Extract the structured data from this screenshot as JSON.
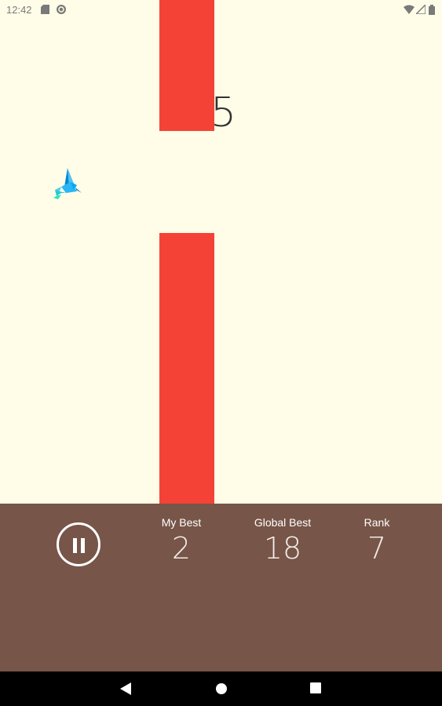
{
  "status_bar": {
    "time": "12:42"
  },
  "game": {
    "score": "5"
  },
  "scoreboard": {
    "my_best_label": "My Best",
    "my_best_value": "2",
    "global_best_label": "Global Best",
    "global_best_value": "18",
    "rank_label": "Rank",
    "rank_value": "7"
  },
  "colors": {
    "background": "#FFFDE8",
    "pipe": "#F44336",
    "panel": "#775548",
    "bird": "#29B6F6"
  },
  "icons": {
    "status_left": [
      "sd-card-icon",
      "sync-icon"
    ],
    "status_right": [
      "wifi-icon",
      "signal-icon",
      "battery-icon"
    ],
    "nav": [
      "back-icon",
      "home-icon",
      "recents-icon"
    ],
    "game": [
      "hummingbird-icon",
      "pause-icon"
    ]
  }
}
